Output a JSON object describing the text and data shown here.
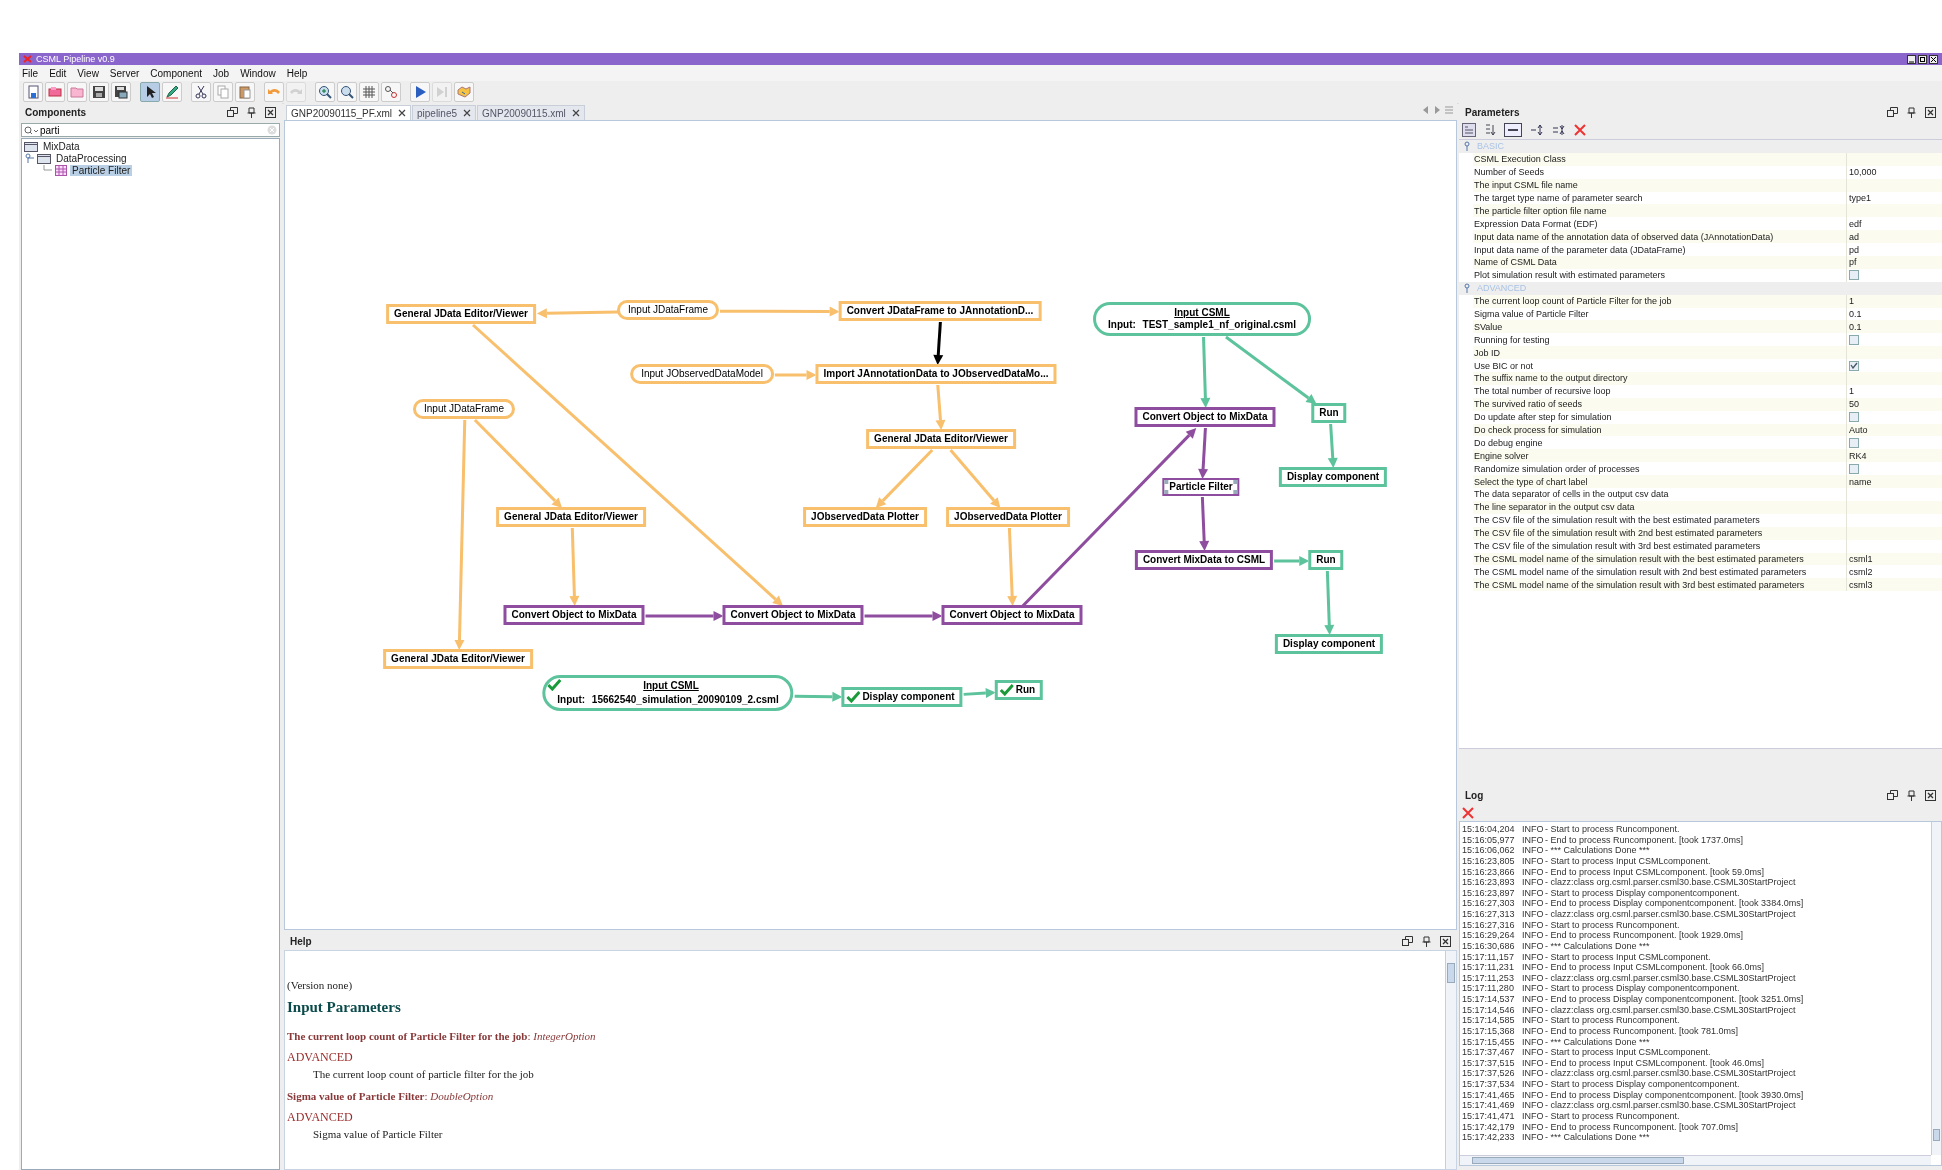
{
  "window": {
    "title": "CSML Pipeline v0.9"
  },
  "menu": [
    "File",
    "Edit",
    "View",
    "Server",
    "Component",
    "Job",
    "Window",
    "Help"
  ],
  "toolbar": [
    [
      {
        "kind": "new",
        "selected": false,
        "disabled": false
      },
      {
        "kind": "open",
        "selected": false,
        "disabled": false
      },
      {
        "kind": "folder",
        "selected": false,
        "disabled": false
      },
      {
        "kind": "save",
        "selected": false,
        "disabled": false
      },
      {
        "kind": "save-all",
        "selected": false,
        "disabled": false
      }
    ],
    [
      {
        "kind": "pointer",
        "selected": true,
        "disabled": false
      },
      {
        "kind": "pen",
        "selected": false,
        "disabled": false
      }
    ],
    [
      {
        "kind": "cut",
        "selected": false,
        "disabled": false
      },
      {
        "kind": "copy",
        "selected": false,
        "disabled": false
      },
      {
        "kind": "paste",
        "selected": false,
        "disabled": false
      }
    ],
    [
      {
        "kind": "undo",
        "selected": false,
        "disabled": false
      },
      {
        "kind": "redo",
        "selected": false,
        "disabled": true
      }
    ],
    [
      {
        "kind": "zoom-in",
        "selected": false,
        "disabled": false
      },
      {
        "kind": "zoom-out",
        "selected": false,
        "disabled": false
      },
      {
        "kind": "grid",
        "selected": false,
        "disabled": false
      },
      {
        "kind": "connect",
        "selected": false,
        "disabled": false
      }
    ],
    [
      {
        "kind": "run",
        "selected": false,
        "disabled": false
      },
      {
        "kind": "step",
        "selected": false,
        "disabled": true
      },
      {
        "kind": "deploy",
        "selected": false,
        "disabled": false
      }
    ]
  ],
  "components": {
    "title": "Components",
    "search": {
      "value": "parti"
    },
    "tree": [
      {
        "label": "MixData",
        "selected": false
      },
      {
        "label": "DataProcessing",
        "selected": false,
        "children": [
          {
            "label": "Particle Filter",
            "selected": true
          }
        ]
      }
    ]
  },
  "editor": {
    "tabs": [
      {
        "label": "GNP20090115_PF.xml",
        "selected": true
      },
      {
        "label": "pipeline5",
        "selected": false
      },
      {
        "label": "GNP20090115.xml",
        "selected": false
      }
    ],
    "diagram": {
      "nodes": [
        {
          "kind": "box",
          "color": "#f8bf6c",
          "label": "General JData Editor/Viewer",
          "selected": false,
          "done": false
        },
        {
          "kind": "pill",
          "color": "#f8bf6c",
          "label": "Input JDataFrame",
          "selected": false,
          "done": false
        },
        {
          "kind": "box",
          "color": "#f8bf6c",
          "label": "Convert JDataFrame to JAnnotationD...",
          "selected": false,
          "done": false
        },
        {
          "kind": "pill",
          "color": "#f8bf6c",
          "label": "Input JObservedDataModel",
          "selected": false,
          "done": false
        },
        {
          "kind": "box",
          "color": "#f8bf6c",
          "label": "Import JAnnotationData to JObservedDataMo...",
          "selected": false,
          "done": false
        },
        {
          "kind": "pill",
          "color": "#f8bf6c",
          "label": "Input JDataFrame",
          "selected": false,
          "done": false
        },
        {
          "kind": "box",
          "color": "#f8bf6c",
          "label": "General JData Editor/Viewer",
          "selected": false,
          "done": false
        },
        {
          "kind": "box",
          "color": "#f8bf6c",
          "label": "General JData Editor/Viewer",
          "selected": false,
          "done": false
        },
        {
          "kind": "box",
          "color": "#f8bf6c",
          "label": "JObservedData Plotter",
          "selected": false,
          "done": false
        },
        {
          "kind": "box",
          "color": "#f8bf6c",
          "label": "JObservedData Plotter",
          "selected": false,
          "done": false
        },
        {
          "kind": "box",
          "color": "#8e4d9e",
          "label": "Convert Object to MixData",
          "selected": false,
          "done": false
        },
        {
          "kind": "box",
          "color": "#8e4d9e",
          "label": "Convert Object to MixData",
          "selected": false,
          "done": false
        },
        {
          "kind": "box",
          "color": "#8e4d9e",
          "label": "Convert Object to MixData",
          "selected": false,
          "done": false
        },
        {
          "kind": "box",
          "color": "#f8bf6c",
          "label": "General JData Editor/Viewer",
          "selected": false,
          "done": false
        },
        {
          "kind": "input",
          "color": "#5cc39c",
          "label": "Input CSML",
          "field_label": "Input:",
          "value": "15662540_simulation_20090109_2.csml",
          "selected": false,
          "done": true
        },
        {
          "kind": "box",
          "color": "#5cc39c",
          "label": "Display component",
          "selected": false,
          "done": true
        },
        {
          "kind": "box",
          "color": "#5cc39c",
          "label": "Run",
          "selected": false,
          "done": true
        },
        {
          "kind": "input",
          "color": "#5cc39c",
          "label": "Input CSML",
          "field_label": "Input:",
          "value": "TEST_sample1_nf_original.csml",
          "selected": false,
          "done": false
        },
        {
          "kind": "box",
          "color": "#8e4d9e",
          "label": "Convert Object to MixData",
          "selected": false,
          "done": false
        },
        {
          "kind": "box",
          "color": "#5cc39c",
          "label": "Run",
          "selected": false,
          "done": false
        },
        {
          "kind": "box",
          "color": "#5cc39c",
          "label": "Display component",
          "selected": false,
          "done": false
        },
        {
          "kind": "box",
          "color": "#8e4d9e",
          "label": "Particle Filter",
          "selected": true,
          "done": false
        },
        {
          "kind": "box",
          "color": "#8e4d9e",
          "label": "Convert MixData to CSML",
          "selected": false,
          "done": false
        },
        {
          "kind": "box",
          "color": "#5cc39c",
          "label": "Run",
          "selected": false,
          "done": false
        },
        {
          "kind": "box",
          "color": "#5cc39c",
          "label": "Display component",
          "selected": false,
          "done": false
        }
      ],
      "edges": [
        {
          "color": "#f8bf6c"
        },
        {
          "color": "#f8bf6c"
        },
        {
          "color": "#000000"
        },
        {
          "color": "#f8bf6c"
        },
        {
          "color": "#f8bf6c"
        },
        {
          "color": "#f8bf6c"
        },
        {
          "color": "#f8bf6c"
        },
        {
          "color": "#f8bf6c"
        },
        {
          "color": "#f8bf6c"
        },
        {
          "color": "#f8bf6c"
        },
        {
          "color": "#f8bf6c"
        },
        {
          "color": "#8e4d9e"
        },
        {
          "color": "#8e4d9e"
        },
        {
          "color": "#f8bf6c"
        },
        {
          "color": "#8e4d9e"
        },
        {
          "color": "#5cc39c"
        },
        {
          "color": "#5cc39c"
        },
        {
          "color": "#5cc39c"
        },
        {
          "color": "#8e4d9e"
        },
        {
          "color": "#8e4d9e"
        },
        {
          "color": "#5cc39c"
        },
        {
          "color": "#5cc39c"
        },
        {
          "color": "#5cc39c"
        },
        {
          "color": "#5cc39c"
        }
      ]
    }
  },
  "help": {
    "title": "Help",
    "version": "(Version none)",
    "heading": "Input Parameters",
    "options": [
      {
        "title": "**The current loop count of Particle Filter for the job**: *IntegerOption*",
        "category": "ADVANCED",
        "description": "The current loop count of particle filter for the job"
      },
      {
        "title": "**Sigma value of Particle Filter**: *DoubleOption*",
        "category": "ADVANCED",
        "description": "Sigma value of Particle Filter"
      }
    ]
  },
  "parameters": {
    "title": "Parameters",
    "sections": [
      {
        "label": "BASIC",
        "expanded": true,
        "rows": [
          {
            "kind": "text",
            "name": "CSML Execution Class"
          },
          {
            "kind": "text",
            "name": "Number of Seeds",
            "value": "10,000"
          },
          {
            "kind": "text",
            "name": "The input CSML file name"
          },
          {
            "kind": "text",
            "name": "The target type name of parameter search",
            "value": "type1"
          },
          {
            "kind": "text",
            "name": "The particle filter option file name"
          },
          {
            "kind": "text",
            "name": "Expression Data Format (EDF)",
            "value": "edf"
          },
          {
            "kind": "text",
            "name": "Input data name of the annotation data of observed data (JAnnotationData)",
            "value": "ad"
          },
          {
            "kind": "text",
            "name": "Input data name of the parameter data (JDataFrame)",
            "value": "pd"
          },
          {
            "kind": "text",
            "name": "Name of CSML Data",
            "value": "pf"
          },
          {
            "kind": "checkbox",
            "name": "Plot simulation result with estimated parameters",
            "checked": false
          }
        ]
      },
      {
        "label": "ADVANCED",
        "expanded": true,
        "rows": [
          {
            "kind": "text",
            "name": "The current loop count of Particle Filter for the job",
            "value": "1"
          },
          {
            "kind": "text",
            "name": "Sigma value of Particle Filter",
            "value": "0.1"
          },
          {
            "kind": "text",
            "name": "SValue",
            "value": "0.1"
          },
          {
            "kind": "checkbox",
            "name": "Running for testing",
            "checked": false
          },
          {
            "kind": "text",
            "name": "Job ID"
          },
          {
            "kind": "checkbox",
            "name": "Use BIC or not",
            "checked": true
          },
          {
            "kind": "text",
            "name": "The suffix name to the output directory"
          },
          {
            "kind": "text",
            "name": "The total number of recursive loop",
            "value": "1"
          },
          {
            "kind": "text",
            "name": "The survived ratio of seeds",
            "value": "50"
          },
          {
            "kind": "checkbox",
            "name": "Do update after step for simulation",
            "checked": false
          },
          {
            "kind": "text",
            "name": "Do check process for simulation",
            "value": "Auto"
          },
          {
            "kind": "checkbox",
            "name": "Do debug engine",
            "checked": false
          },
          {
            "kind": "text",
            "name": "Engine solver",
            "value": "RK4"
          },
          {
            "kind": "checkbox",
            "name": "Randomize simulation order of processes",
            "checked": false
          },
          {
            "kind": "text",
            "name": "Select the type of chart label",
            "value": "name"
          },
          {
            "kind": "text",
            "name": "The data separator of cells in the output csv data"
          },
          {
            "kind": "text",
            "name": "The line separator in the output csv data"
          },
          {
            "kind": "text",
            "name": "The CSV file of the simulation result with the best estimated parameters"
          },
          {
            "kind": "text",
            "name": "The CSV file of the simulation result with 2nd best estimated parameters"
          },
          {
            "kind": "text",
            "name": "The CSV file of the simulation result with 3rd best estimated parameters"
          },
          {
            "kind": "text",
            "name": "The CSML model name of the simulation result with the best estimated parameters",
            "value": "csml1"
          },
          {
            "kind": "text",
            "name": "The CSML model name of the simulation result with 2nd best estimated parameters",
            "value": "csml2"
          },
          {
            "kind": "text",
            "name": "The CSML model name of the simulation result with 3rd best estimated parameters",
            "value": "csml3"
          }
        ]
      }
    ]
  },
  "log": {
    "title": "Log",
    "entries": [
      {
        "time": "15:16:04,204",
        "level": "INFO",
        "message": "- Start to process Runcomponent."
      },
      {
        "time": "15:16:05,977",
        "level": "INFO",
        "message": "- End to process Runcomponent. [took 1737.0ms]"
      },
      {
        "time": "15:16:06,062",
        "level": "INFO",
        "message": "- *** Calculations Done ***"
      },
      {
        "time": "15:16:23,805",
        "level": "INFO",
        "message": "- Start to process Input CSMLcomponent."
      },
      {
        "time": "15:16:23,866",
        "level": "INFO",
        "message": "- End to process Input CSMLcomponent. [took 59.0ms]"
      },
      {
        "time": "15:16:23,893",
        "level": "INFO",
        "message": "- clazz:class org.csml.parser.csml30.base.CSML30StartProject"
      },
      {
        "time": "15:16:23,897",
        "level": "INFO",
        "message": "- Start to process Display componentcomponent."
      },
      {
        "time": "15:16:27,303",
        "level": "INFO",
        "message": "- End to process Display componentcomponent. [took 3384.0ms]"
      },
      {
        "time": "15:16:27,313",
        "level": "INFO",
        "message": "- clazz:class org.csml.parser.csml30.base.CSML30StartProject"
      },
      {
        "time": "15:16:27,316",
        "level": "INFO",
        "message": "- Start to process Runcomponent."
      },
      {
        "time": "15:16:29,264",
        "level": "INFO",
        "message": "- End to process Runcomponent. [took 1929.0ms]"
      },
      {
        "time": "15:16:30,686",
        "level": "INFO",
        "message": "- *** Calculations Done ***"
      },
      {
        "time": "15:17:11,157",
        "level": "INFO",
        "message": "- Start to process Input CSMLcomponent."
      },
      {
        "time": "15:17:11,231",
        "level": "INFO",
        "message": "- End to process Input CSMLcomponent. [took 66.0ms]"
      },
      {
        "time": "15:17:11,253",
        "level": "INFO",
        "message": "- clazz:class org.csml.parser.csml30.base.CSML30StartProject"
      },
      {
        "time": "15:17:11,280",
        "level": "INFO",
        "message": "- Start to process Display componentcomponent."
      },
      {
        "time": "15:17:14,537",
        "level": "INFO",
        "message": "- End to process Display componentcomponent. [took 3251.0ms]"
      },
      {
        "time": "15:17:14,546",
        "level": "INFO",
        "message": "- clazz:class org.csml.parser.csml30.base.CSML30StartProject"
      },
      {
        "time": "15:17:14,585",
        "level": "INFO",
        "message": "- Start to process Runcomponent."
      },
      {
        "time": "15:17:15,368",
        "level": "INFO",
        "message": "- End to process Runcomponent. [took 781.0ms]"
      },
      {
        "time": "15:17:15,455",
        "level": "INFO",
        "message": "- *** Calculations Done ***"
      },
      {
        "time": "15:17:37,467",
        "level": "INFO",
        "message": "- Start to process Input CSMLcomponent."
      },
      {
        "time": "15:17:37,515",
        "level": "INFO",
        "message": "- End to process Input CSMLcomponent. [took 46.0ms]"
      },
      {
        "time": "15:17:37,526",
        "level": "INFO",
        "message": "- clazz:class org.csml.parser.csml30.base.CSML30StartProject"
      },
      {
        "time": "15:17:37,534",
        "level": "INFO",
        "message": "- Start to process Display componentcomponent."
      },
      {
        "time": "15:17:41,465",
        "level": "INFO",
        "message": "- End to process Display componentcomponent. [took 3930.0ms]"
      },
      {
        "time": "15:17:41,469",
        "level": "INFO",
        "message": "- clazz:class org.csml.parser.csml30.base.CSML30StartProject"
      },
      {
        "time": "15:17:41,471",
        "level": "INFO",
        "message": "- Start to process Runcomponent."
      },
      {
        "time": "15:17:42,179",
        "level": "INFO",
        "message": "- End to process Runcomponent. [took 707.0ms]"
      },
      {
        "time": "15:17:42,233",
        "level": "INFO",
        "message": "- *** Calculations Done ***"
      }
    ]
  }
}
